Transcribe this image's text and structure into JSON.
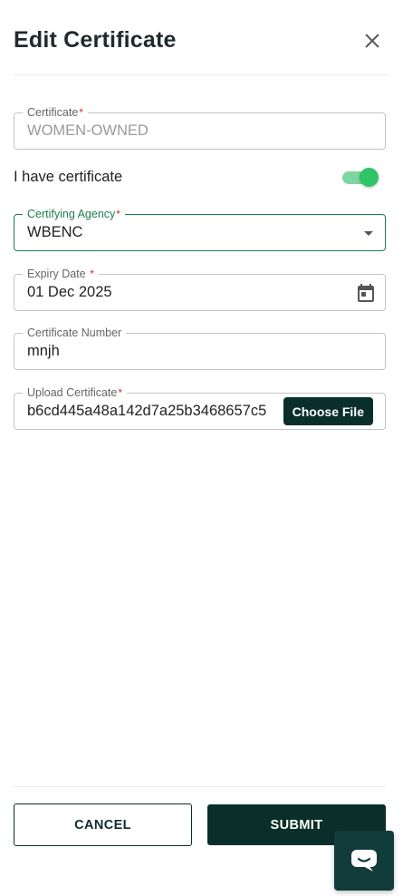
{
  "header": {
    "title": "Edit Certificate",
    "close_icon": "close-icon"
  },
  "fields": {
    "certificate": {
      "label": "Certificate",
      "required_mark": "*",
      "value": "WOMEN-OWNED"
    },
    "toggle": {
      "label": "I have certificate",
      "checked": true
    },
    "agency": {
      "label": "Certifying Agency",
      "required_mark": "*",
      "value": "WBENC",
      "icon": "chevron-down-icon"
    },
    "expiry": {
      "label": "Expiry Date",
      "required_mark": "*",
      "value": "01 Dec 2025",
      "icon": "calendar-icon"
    },
    "number": {
      "label": "Certificate Number",
      "value": "mnjh"
    },
    "upload": {
      "label": "Upload Certificate",
      "required_mark": "*",
      "value": "b6cd445a48a142d7a25b3468657c5",
      "button_label": "Choose File"
    }
  },
  "footer": {
    "cancel_label": "CANCEL",
    "submit_label": "SUBMIT"
  },
  "chat": {
    "icon": "chat-icon"
  },
  "colors": {
    "primary_dark": "#0a2f2b",
    "focus_green": "#1e7d4f",
    "toggle_on": "#2fc466",
    "required_red": "#d32f2f"
  }
}
